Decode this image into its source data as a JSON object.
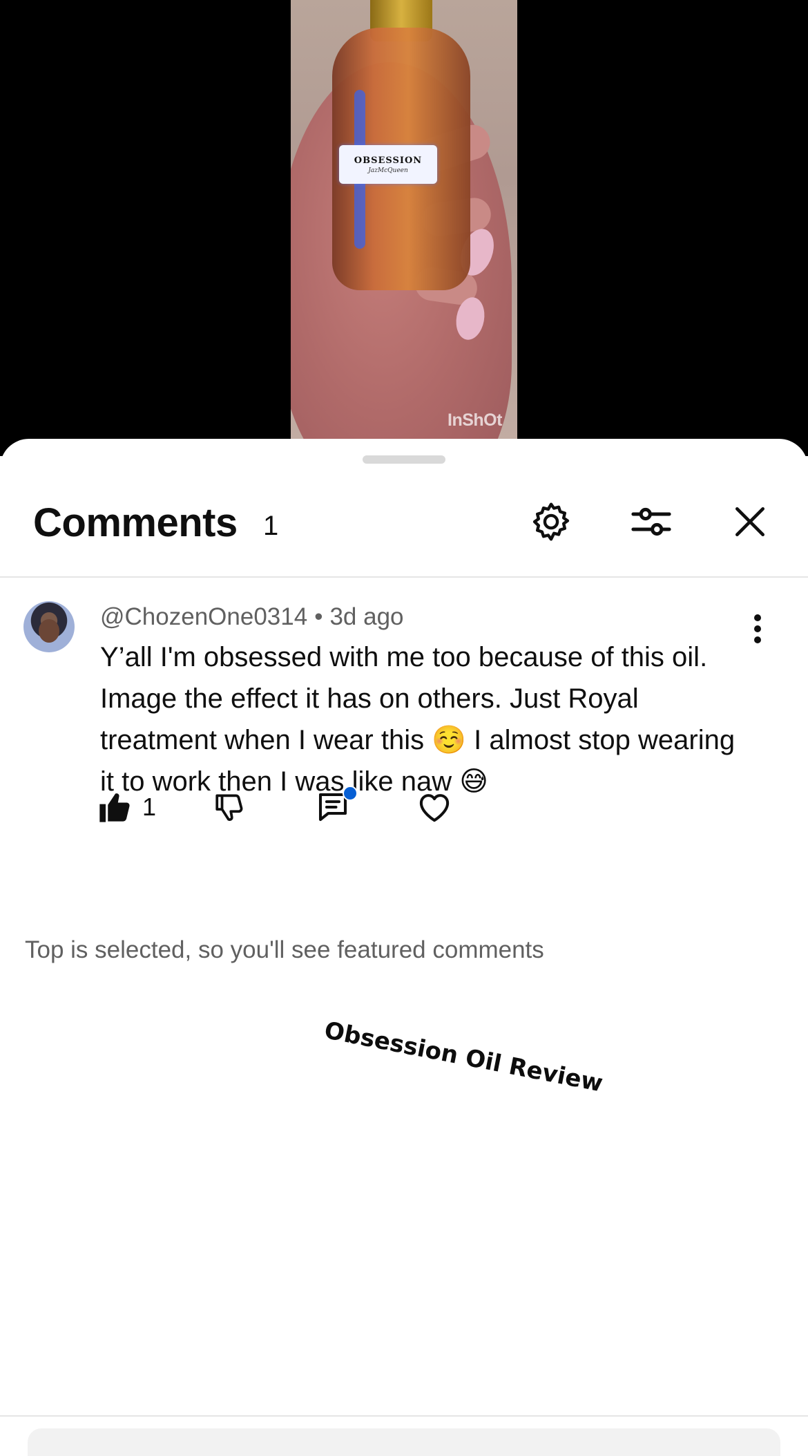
{
  "video": {
    "label_title": "OBSESSION",
    "label_subtitle": "JazMcQueen",
    "watermark": "InShOt"
  },
  "header": {
    "title": "Comments",
    "count": "1",
    "icons": [
      "settings-gear-icon",
      "filter-sliders-icon",
      "close-icon"
    ]
  },
  "comment": {
    "author": "@ChozenOne0314",
    "separator": "•",
    "time": "3d ago",
    "text": "Y’all I'm obsessed with me too because of this oil. Image the effect it has on others. Just Royal treatment when I wear this ☺️ I almost stop wearing it to work then I was like naw 😅",
    "like_count": "1",
    "reply_indicator_color": "#065fd4"
  },
  "notice": "Top is selected, so you'll see featured comments",
  "overlay_caption": "Obsession Oil Review"
}
